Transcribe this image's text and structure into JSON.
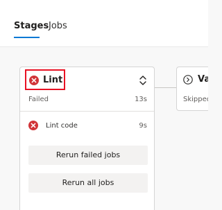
{
  "tabs": [
    {
      "label": "Stages",
      "selected": true
    },
    {
      "label": "Jobs",
      "selected": false
    }
  ],
  "stage": {
    "name": "Lint",
    "status": "Failed",
    "duration": "13s",
    "status_icon": "error-circle-icon",
    "expand_icon": "chevron-up-down-icon",
    "jobs": [
      {
        "name": "Lint code",
        "duration": "9s",
        "status_icon": "error-circle-icon"
      }
    ],
    "rerun_failed_label": "Rerun failed jobs",
    "rerun_all_label": "Rerun all jobs"
  },
  "next_stage": {
    "name": "Val",
    "status": "Skipped",
    "status_icon": "skipped-circle-icon"
  },
  "colors": {
    "accent": "#0078d4",
    "error": "#d13438",
    "highlight_border": "#e81123"
  }
}
